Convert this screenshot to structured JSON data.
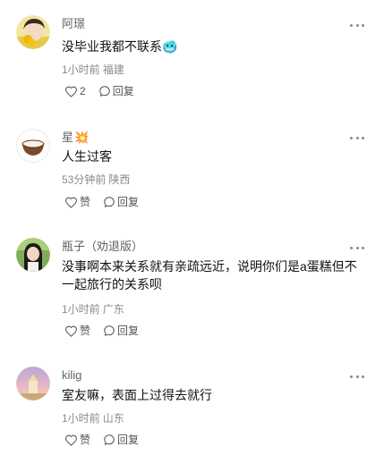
{
  "comments": [
    {
      "author": "阿璟",
      "author_badge": "",
      "text": "没毕业我都不联系🥶",
      "time": "1小时前",
      "location": "福建",
      "like_label": "2",
      "reply_label": "回复",
      "avatar_icon": "avatar-girl-yellow"
    },
    {
      "author": "星",
      "author_badge": "💥",
      "text": "人生过客",
      "time": "53分钟前",
      "location": "陕西",
      "like_label": "赞",
      "reply_label": "回复",
      "avatar_icon": "avatar-coconut-bowl"
    },
    {
      "author": "瓶子（劝退版）",
      "author_badge": "",
      "text": "没事啊本来关系就有亲疏远近，说明你们是a蛋糕但不一起旅行的关系呗",
      "time": "1小时前",
      "location": "广东",
      "like_label": "赞",
      "reply_label": "回复",
      "avatar_icon": "avatar-girl-outdoor"
    },
    {
      "author": "kilig",
      "author_badge": "",
      "text": "室友嘛，表面上过得去就行",
      "time": "1小时前",
      "location": "山东",
      "like_label": "赞",
      "reply_label": "回复",
      "avatar_icon": "avatar-sunset-castle"
    }
  ],
  "colors": {
    "author": "#5f6368",
    "meta": "#8a8a8a",
    "text": "#111111",
    "action": "#555555"
  }
}
